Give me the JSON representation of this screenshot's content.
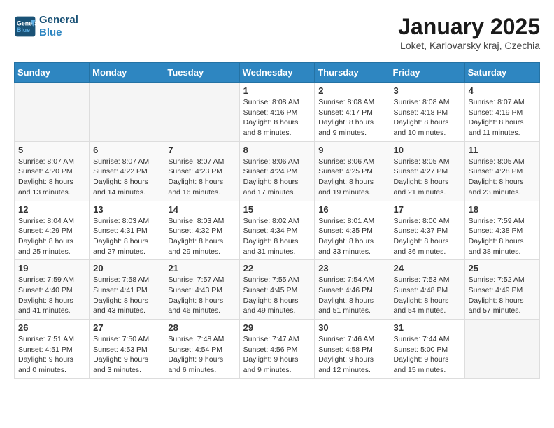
{
  "header": {
    "logo_line1": "General",
    "logo_line2": "Blue",
    "month_title": "January 2025",
    "location": "Loket, Karlovarsky kraj, Czechia"
  },
  "days_of_week": [
    "Sunday",
    "Monday",
    "Tuesday",
    "Wednesday",
    "Thursday",
    "Friday",
    "Saturday"
  ],
  "weeks": [
    [
      {
        "day": "",
        "text": ""
      },
      {
        "day": "",
        "text": ""
      },
      {
        "day": "",
        "text": ""
      },
      {
        "day": "1",
        "text": "Sunrise: 8:08 AM\nSunset: 4:16 PM\nDaylight: 8 hours and 8 minutes."
      },
      {
        "day": "2",
        "text": "Sunrise: 8:08 AM\nSunset: 4:17 PM\nDaylight: 8 hours and 9 minutes."
      },
      {
        "day": "3",
        "text": "Sunrise: 8:08 AM\nSunset: 4:18 PM\nDaylight: 8 hours and 10 minutes."
      },
      {
        "day": "4",
        "text": "Sunrise: 8:07 AM\nSunset: 4:19 PM\nDaylight: 8 hours and 11 minutes."
      }
    ],
    [
      {
        "day": "5",
        "text": "Sunrise: 8:07 AM\nSunset: 4:20 PM\nDaylight: 8 hours and 13 minutes."
      },
      {
        "day": "6",
        "text": "Sunrise: 8:07 AM\nSunset: 4:22 PM\nDaylight: 8 hours and 14 minutes."
      },
      {
        "day": "7",
        "text": "Sunrise: 8:07 AM\nSunset: 4:23 PM\nDaylight: 8 hours and 16 minutes."
      },
      {
        "day": "8",
        "text": "Sunrise: 8:06 AM\nSunset: 4:24 PM\nDaylight: 8 hours and 17 minutes."
      },
      {
        "day": "9",
        "text": "Sunrise: 8:06 AM\nSunset: 4:25 PM\nDaylight: 8 hours and 19 minutes."
      },
      {
        "day": "10",
        "text": "Sunrise: 8:05 AM\nSunset: 4:27 PM\nDaylight: 8 hours and 21 minutes."
      },
      {
        "day": "11",
        "text": "Sunrise: 8:05 AM\nSunset: 4:28 PM\nDaylight: 8 hours and 23 minutes."
      }
    ],
    [
      {
        "day": "12",
        "text": "Sunrise: 8:04 AM\nSunset: 4:29 PM\nDaylight: 8 hours and 25 minutes."
      },
      {
        "day": "13",
        "text": "Sunrise: 8:03 AM\nSunset: 4:31 PM\nDaylight: 8 hours and 27 minutes."
      },
      {
        "day": "14",
        "text": "Sunrise: 8:03 AM\nSunset: 4:32 PM\nDaylight: 8 hours and 29 minutes."
      },
      {
        "day": "15",
        "text": "Sunrise: 8:02 AM\nSunset: 4:34 PM\nDaylight: 8 hours and 31 minutes."
      },
      {
        "day": "16",
        "text": "Sunrise: 8:01 AM\nSunset: 4:35 PM\nDaylight: 8 hours and 33 minutes."
      },
      {
        "day": "17",
        "text": "Sunrise: 8:00 AM\nSunset: 4:37 PM\nDaylight: 8 hours and 36 minutes."
      },
      {
        "day": "18",
        "text": "Sunrise: 7:59 AM\nSunset: 4:38 PM\nDaylight: 8 hours and 38 minutes."
      }
    ],
    [
      {
        "day": "19",
        "text": "Sunrise: 7:59 AM\nSunset: 4:40 PM\nDaylight: 8 hours and 41 minutes."
      },
      {
        "day": "20",
        "text": "Sunrise: 7:58 AM\nSunset: 4:41 PM\nDaylight: 8 hours and 43 minutes."
      },
      {
        "day": "21",
        "text": "Sunrise: 7:57 AM\nSunset: 4:43 PM\nDaylight: 8 hours and 46 minutes."
      },
      {
        "day": "22",
        "text": "Sunrise: 7:55 AM\nSunset: 4:45 PM\nDaylight: 8 hours and 49 minutes."
      },
      {
        "day": "23",
        "text": "Sunrise: 7:54 AM\nSunset: 4:46 PM\nDaylight: 8 hours and 51 minutes."
      },
      {
        "day": "24",
        "text": "Sunrise: 7:53 AM\nSunset: 4:48 PM\nDaylight: 8 hours and 54 minutes."
      },
      {
        "day": "25",
        "text": "Sunrise: 7:52 AM\nSunset: 4:49 PM\nDaylight: 8 hours and 57 minutes."
      }
    ],
    [
      {
        "day": "26",
        "text": "Sunrise: 7:51 AM\nSunset: 4:51 PM\nDaylight: 9 hours and 0 minutes."
      },
      {
        "day": "27",
        "text": "Sunrise: 7:50 AM\nSunset: 4:53 PM\nDaylight: 9 hours and 3 minutes."
      },
      {
        "day": "28",
        "text": "Sunrise: 7:48 AM\nSunset: 4:54 PM\nDaylight: 9 hours and 6 minutes."
      },
      {
        "day": "29",
        "text": "Sunrise: 7:47 AM\nSunset: 4:56 PM\nDaylight: 9 hours and 9 minutes."
      },
      {
        "day": "30",
        "text": "Sunrise: 7:46 AM\nSunset: 4:58 PM\nDaylight: 9 hours and 12 minutes."
      },
      {
        "day": "31",
        "text": "Sunrise: 7:44 AM\nSunset: 5:00 PM\nDaylight: 9 hours and 15 minutes."
      },
      {
        "day": "",
        "text": ""
      }
    ]
  ]
}
